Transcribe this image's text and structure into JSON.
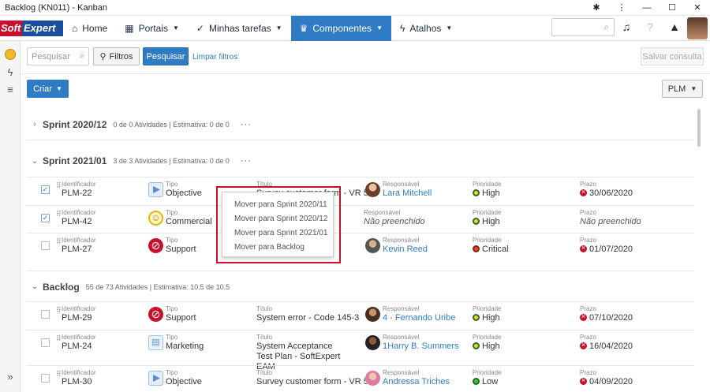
{
  "window": {
    "title": "Backlog (KN011) - Kanban"
  },
  "logo": {
    "part1": "Soft",
    "part2": "Expert"
  },
  "nav": [
    {
      "label": "Home",
      "icon": "home-icon",
      "active": false
    },
    {
      "label": "Portais",
      "icon": "grid-icon",
      "active": false
    },
    {
      "label": "Minhas tarefas",
      "icon": "check-icon",
      "active": false
    },
    {
      "label": "Componentes",
      "icon": "trophy-icon",
      "active": true
    },
    {
      "label": "Atalhos",
      "icon": "bolt-icon",
      "active": false
    }
  ],
  "toolbar": {
    "search_placeholder": "Pesquisar",
    "filter_label": "Filtros",
    "search_label": "Pesquisar",
    "clear_label": "Limpar filtros",
    "save_label": "Salvar consulta"
  },
  "create_label": "Criar",
  "plm_label": "PLM",
  "sections": [
    {
      "name": "Sprint 2020/12",
      "meta": "0 de 0 Atividades | Estimativa: 0 de 0",
      "dots": "···"
    },
    {
      "name": "Sprint 2021/01",
      "meta": "3 de 3 Atividades | Estimativa: 0 de 0",
      "dots": "···"
    },
    {
      "name": "Backlog",
      "meta": "55 de 73 Atividades | Estimativa: 10.5 de 10.5",
      "dots": ""
    }
  ],
  "labels": {
    "id": "Identificador",
    "tipo": "Tipo",
    "titulo": "Título",
    "resp": "Responsável",
    "prio": "Prioridade",
    "prazo": "Prazo"
  },
  "sprint_rows": [
    {
      "checked": true,
      "id": "PLM-22",
      "tipo": "Objective",
      "titulo": "Survey customer form - VR 5",
      "resp": "Lara Mitchell",
      "resp_missing": false,
      "prio": "High",
      "prazo": "30/06/2020"
    },
    {
      "checked": true,
      "id": "PLM-42",
      "tipo": "Commercial",
      "titulo": "",
      "resp": "Não preenchido",
      "resp_missing": true,
      "prio": "High",
      "prazo": "Não preenchido"
    },
    {
      "checked": false,
      "id": "PLM-27",
      "tipo": "Support",
      "titulo": "",
      "resp": "Kevin Reed",
      "resp_missing": false,
      "prio": "Critical",
      "prazo": "01/07/2020"
    }
  ],
  "backlog_rows": [
    {
      "checked": false,
      "id": "PLM-29",
      "tipo": "Support",
      "titulo": "System error - Code 145-3",
      "resp": "4 - Fernando Uribe",
      "prio": "High",
      "prazo": "07/10/2020"
    },
    {
      "checked": false,
      "id": "PLM-24",
      "tipo": "Marketing",
      "titulo": "System Acceptance Test Plan - SoftExpert EAM",
      "resp": "1Harry B. Summers",
      "prio": "High",
      "prazo": "16/04/2020"
    },
    {
      "checked": false,
      "id": "PLM-30",
      "tipo": "Objective",
      "titulo": "Survey customer form - VR 5",
      "resp": "Andressa Triches",
      "prio": "Low",
      "prazo": "04/09/2020"
    }
  ],
  "context_menu": [
    "Mover para Sprint 2020/11",
    "Mover para Sprint 2020/12",
    "Mover para Sprint 2021/01",
    "Mover para Backlog"
  ],
  "colors": {
    "accent": "#2f7cc4",
    "brand_red": "#c8102e",
    "brand_blue": "#1a4e9c"
  }
}
